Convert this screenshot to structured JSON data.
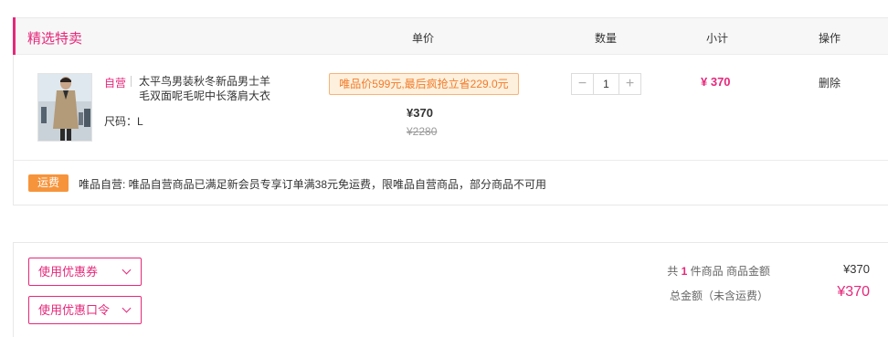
{
  "header": {
    "section_title": "精选特卖",
    "col_price": "单价",
    "col_qty": "数量",
    "col_subtotal": "小计",
    "col_action": "操作"
  },
  "item": {
    "self_tag": "自营",
    "name": "太平鸟男装秋冬新品男士羊毛双面呢毛呢中长落肩大衣",
    "size_label": "尺码：L",
    "promo": "唯品价599元,最后疯抢立省229.0元",
    "price_now": "¥370",
    "price_original": "¥2280",
    "quantity": "1",
    "minus": "−",
    "plus": "+",
    "subtotal": "¥ 370",
    "delete_label": "删除"
  },
  "shipping": {
    "badge": "运费",
    "text": "唯品自营: 唯品自营商品已满足新会员专享订单满38元免运费，限唯品自营商品，部分商品不可用"
  },
  "summary": {
    "coupon_button": "使用优惠券",
    "code_button": "使用优惠口令",
    "count_prefix": "共",
    "count": "1",
    "count_suffix": "件商品  商品金额",
    "goods_amount": "¥370",
    "total_label": "总金额（未含运费）",
    "total_amount": "¥370"
  },
  "colors": {
    "accent": "#e5287a",
    "shipping_badge": "#f6943c",
    "promo_text": "#f27b2a"
  },
  "icons": {
    "chevron": "chevron-down-icon",
    "product_image": "coat-product-photo"
  }
}
